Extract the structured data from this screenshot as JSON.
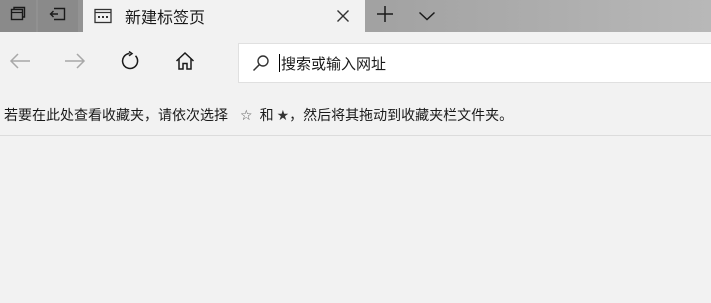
{
  "tabstrip": {
    "tab_title": "新建标签页",
    "icons": {
      "set_aside": "tabs-preview-icon",
      "restore": "set-aside-tabs-icon",
      "favicon": "new-tab-page-icon",
      "close": "close-icon",
      "new_tab": "plus-icon",
      "tab_preview": "chevron-down-icon"
    }
  },
  "navbar": {
    "address_placeholder": "搜索或输入网址",
    "icons": {
      "back": "back-arrow-icon",
      "forward": "forward-arrow-icon",
      "refresh": "refresh-icon",
      "home": "home-icon",
      "search": "search-icon"
    }
  },
  "favorites_bar": {
    "hint_part1": "若要在此处查看收藏夹，请依次选择",
    "star_outline": "☆",
    "hint_and": "和",
    "star_solid": "★",
    "hint_part2": "，然后将其拖动到收藏夹栏文件夹。"
  },
  "colors": {
    "tabstrip_bg": "#9b9b9b",
    "active_tab_bg": "#f2f2f2",
    "toolbar_bg": "#f2f2f2",
    "address_bg": "#ffffff"
  }
}
